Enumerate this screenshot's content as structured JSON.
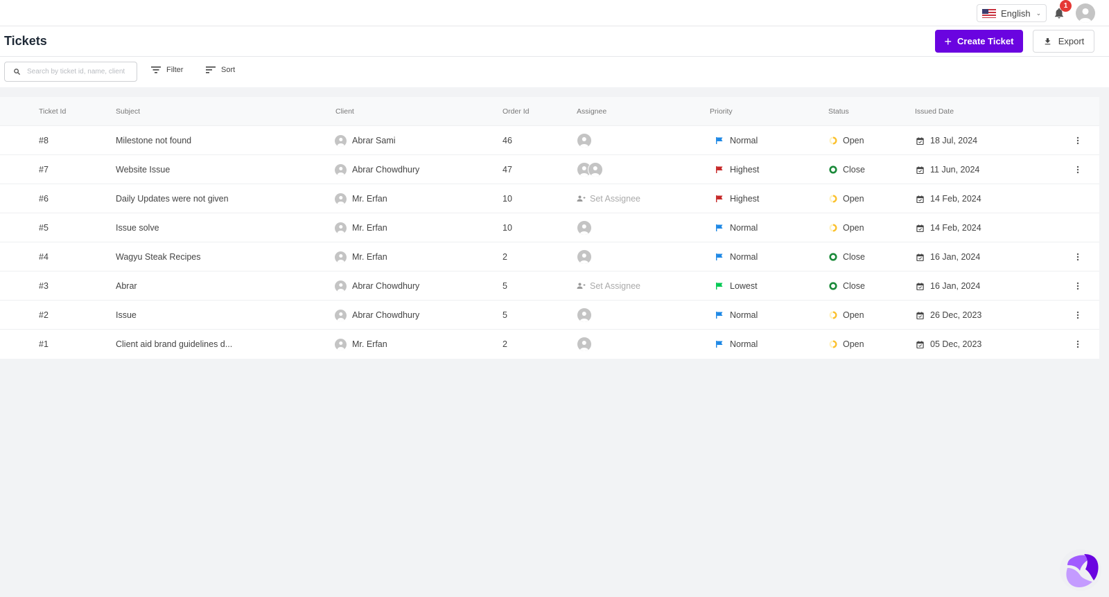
{
  "topbar": {
    "language": "English",
    "language_flag": "us-flag-icon",
    "notification_count": "1"
  },
  "header": {
    "title": "Tickets",
    "create_label": "Create Ticket",
    "export_label": "Export"
  },
  "toolbar": {
    "search_placeholder": "Search by ticket id, name, client",
    "search_value": "",
    "filter_label": "Filter",
    "sort_label": "Sort"
  },
  "table": {
    "columns": [
      "Ticket Id",
      "Subject",
      "Client",
      "Order Id",
      "Assignee",
      "Priority",
      "Status",
      "Issued Date"
    ],
    "rows": [
      {
        "id": "#8",
        "subject": "Milestone not found",
        "client": "Abrar Sami",
        "order_id": "46",
        "assignee": "single",
        "priority": "Normal",
        "status": "Open",
        "date": "18 Jul, 2024",
        "menu": true
      },
      {
        "id": "#7",
        "subject": "Website Issue",
        "client": "Abrar Chowdhury",
        "order_id": "47",
        "assignee": "double",
        "priority": "Highest",
        "status": "Close",
        "date": "11 Jun, 2024",
        "menu": true
      },
      {
        "id": "#6",
        "subject": "Daily Updates were not given",
        "client": "Mr. Erfan",
        "order_id": "10",
        "assignee": "none",
        "priority": "Highest",
        "status": "Open",
        "date": "14 Feb, 2024",
        "menu": false
      },
      {
        "id": "#5",
        "subject": "Issue solve",
        "client": "Mr. Erfan",
        "order_id": "10",
        "assignee": "single",
        "priority": "Normal",
        "status": "Open",
        "date": "14 Feb, 2024",
        "menu": false
      },
      {
        "id": "#4",
        "subject": "Wagyu Steak Recipes",
        "client": "Mr. Erfan",
        "order_id": "2",
        "assignee": "single",
        "priority": "Normal",
        "status": "Close",
        "date": "16 Jan, 2024",
        "menu": true
      },
      {
        "id": "#3",
        "subject": "Abrar",
        "client": "Abrar Chowdhury",
        "order_id": "5",
        "assignee": "none",
        "priority": "Lowest",
        "status": "Close",
        "date": "16 Jan, 2024",
        "menu": true
      },
      {
        "id": "#2",
        "subject": "Issue",
        "client": "Abrar Chowdhury",
        "order_id": "5",
        "assignee": "single",
        "priority": "Normal",
        "status": "Open",
        "date": "26 Dec, 2023",
        "menu": true
      },
      {
        "id": "#1",
        "subject": "Client aid brand guidelines d...",
        "client": "Mr. Erfan",
        "order_id": "2",
        "assignee": "single",
        "priority": "Normal",
        "status": "Open",
        "date": "05 Dec, 2023",
        "menu": true
      }
    ],
    "set_assignee_label": "Set Assignee"
  },
  "colors": {
    "accent": "#6a04e0",
    "priority": {
      "Normal": "#1e88e5",
      "Highest": "#c62828",
      "Lowest": "#00c853"
    },
    "status": {
      "Open": "#fbc02d",
      "Close": "#1b8a3a"
    },
    "badge": "#e53935"
  }
}
